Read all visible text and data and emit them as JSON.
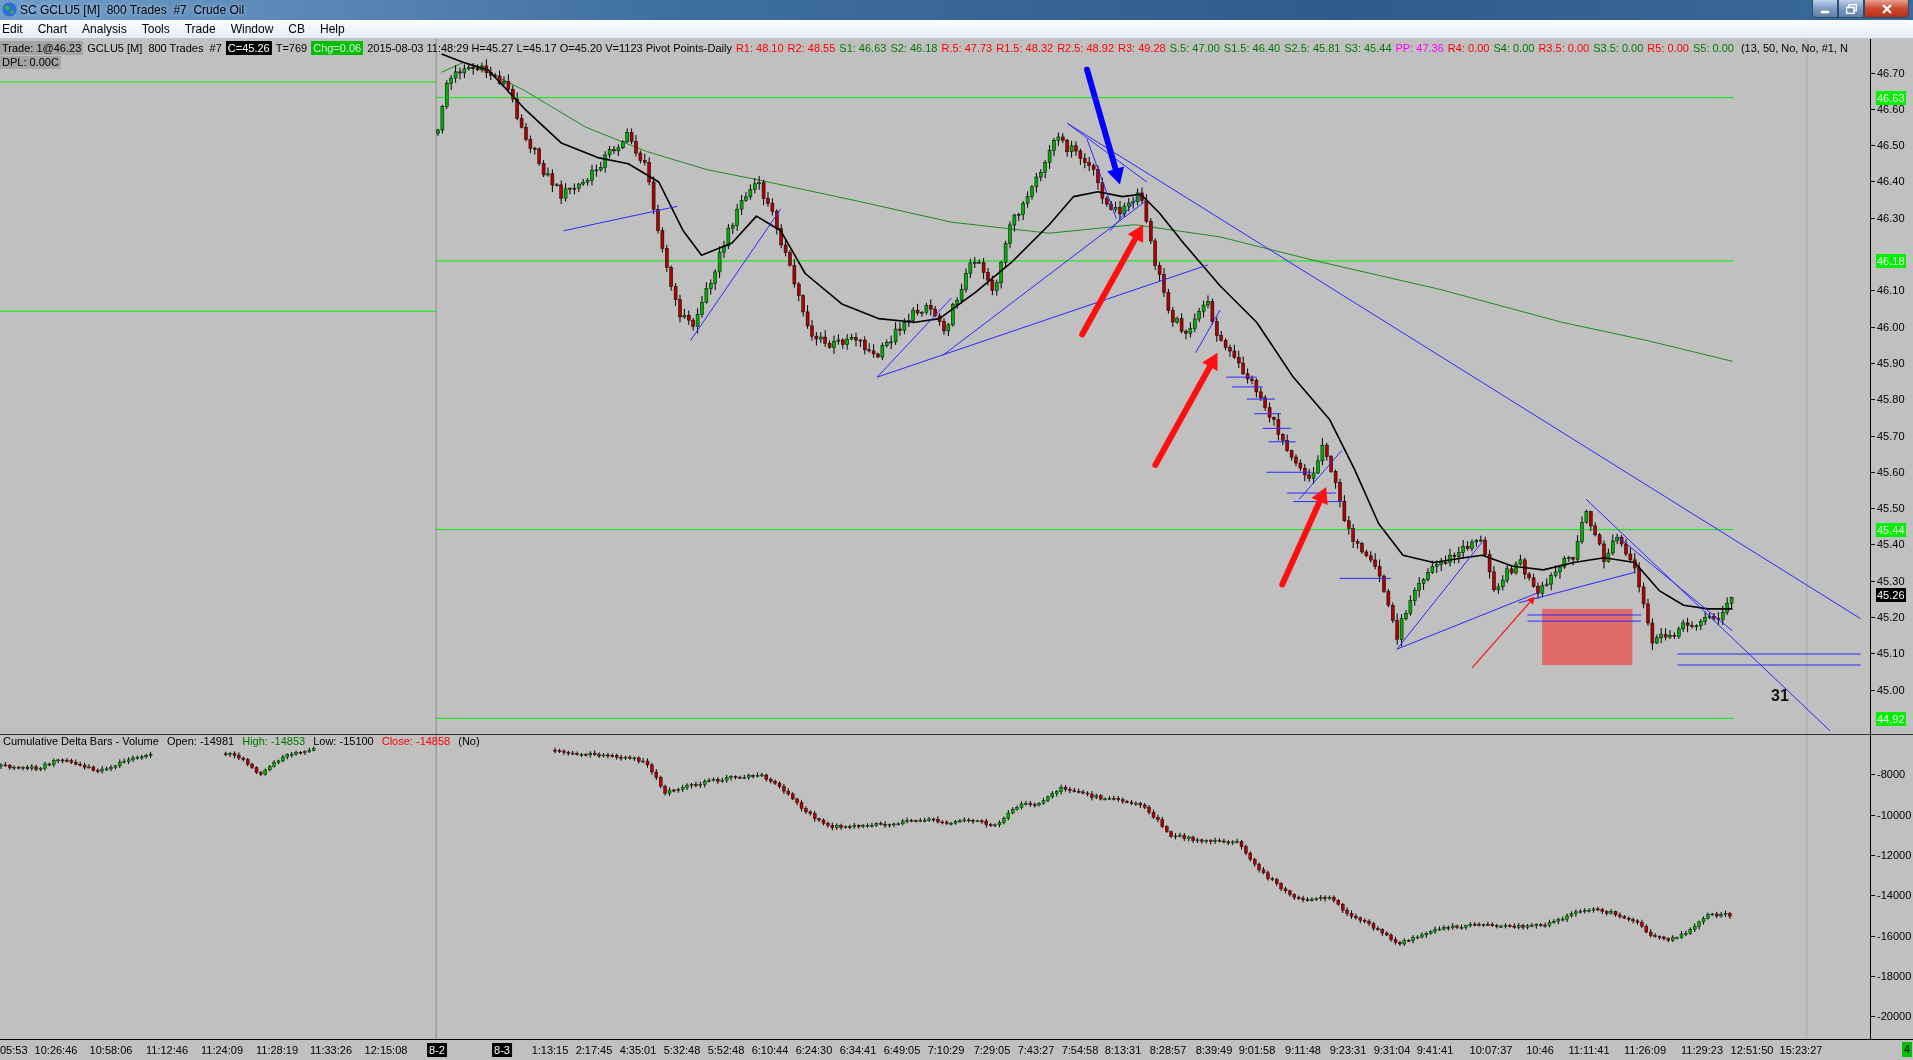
{
  "window": {
    "title": "SC GCLU5 [M]  800 Trades  #7  Crude Oil"
  },
  "menu": [
    "Edit",
    "Chart",
    "Analysis",
    "Tools",
    "Trade",
    "Window",
    "CB",
    "Help"
  ],
  "info_bar": {
    "trade": "Trade: 1@46.23",
    "symbol": "GCLU5 [M]  800 Trades  #7",
    "close": "C=45.26",
    "trades": "T=769",
    "change": "Chg=0.06",
    "bar_info": "2015-08-03 11:48:29 H=45.27 L=45.17 O=45.20 V=1123 Pivot Points-Daily",
    "pivot_values": [
      {
        "text": "R1: 48.10",
        "color": "#ff0000"
      },
      {
        "text": "R2: 48.55",
        "color": "#ff0000"
      },
      {
        "text": "S1: 46.63",
        "color": "#007800"
      },
      {
        "text": "S2: 46.18",
        "color": "#007800"
      },
      {
        "text": "R.5: 47.73",
        "color": "#ff0000"
      },
      {
        "text": "R1.5: 48.32",
        "color": "#ff0000"
      },
      {
        "text": "R2.5: 48.92",
        "color": "#ff0000"
      },
      {
        "text": "R3: 49.28",
        "color": "#ff0000"
      },
      {
        "text": "S.5: 47.00",
        "color": "#007800"
      },
      {
        "text": "S1.5: 46.40",
        "color": "#007800"
      },
      {
        "text": "S2.5: 45.81",
        "color": "#007800"
      },
      {
        "text": "S3: 45.44",
        "color": "#007800"
      },
      {
        "text": "PP: 47.36",
        "color": "#ff00ff"
      },
      {
        "text": "R4: 0.00",
        "color": "#ff0000"
      },
      {
        "text": "S4: 0.00",
        "color": "#007800"
      },
      {
        "text": "R3.5: 0.00",
        "color": "#ff0000"
      },
      {
        "text": "S3.5: 0.00",
        "color": "#007800"
      },
      {
        "text": "R5: 0.00",
        "color": "#ff0000"
      },
      {
        "text": "S5: 0.00",
        "color": "#007800"
      }
    ],
    "study_params": "(13, 50, No, No, #1, N",
    "dpl": "DPL: 0.00C"
  },
  "price_chart": {
    "annotation": "31",
    "price_axis": [
      "46.70",
      "46.60",
      "46.50",
      "46.40",
      "46.30",
      "46.10",
      "46.00",
      "45.90",
      "45.80",
      "45.70",
      "45.60",
      "45.50",
      "45.40",
      "45.30",
      "45.20",
      "45.10",
      "45.00"
    ],
    "level_tags": [
      "46.63",
      "46.18",
      "45.44",
      "44.92"
    ],
    "last_price": "45.26"
  },
  "delta_pane": {
    "title": "Cumulative Delta Bars - Volume",
    "open": "Open: -14981",
    "high": "High: -14853",
    "low": "Low: -15100",
    "close": "Close: -14858",
    "mode": "(No)",
    "axis": [
      "-8000",
      "-10000",
      "-12000",
      "-14000",
      "-16000",
      "-18000",
      "-20000"
    ]
  },
  "time_axis": {
    "labels": [
      {
        "text": "05:53",
        "kind": "time"
      },
      {
        "text": "10:26:46",
        "kind": "time"
      },
      {
        "text": "10:58:06",
        "kind": "time"
      },
      {
        "text": "11:12:46",
        "kind": "time"
      },
      {
        "text": "11:24:09",
        "kind": "time"
      },
      {
        "text": "11:28:19",
        "kind": "time"
      },
      {
        "text": "11:33:26",
        "kind": "time"
      },
      {
        "text": "12:15:08",
        "kind": "time"
      },
      {
        "text": "8-2",
        "kind": "date"
      },
      {
        "text": "8-3",
        "kind": "date"
      },
      {
        "text": "1:13:15",
        "kind": "time"
      },
      {
        "text": "2:17:45",
        "kind": "time"
      },
      {
        "text": "4:35:01",
        "kind": "time"
      },
      {
        "text": "5:32:48",
        "kind": "time"
      },
      {
        "text": "5:52:48",
        "kind": "time"
      },
      {
        "text": "6:10:44",
        "kind": "time"
      },
      {
        "text": "6:24:30",
        "kind": "time"
      },
      {
        "text": "6:34:41",
        "kind": "time"
      },
      {
        "text": "6:49:05",
        "kind": "time"
      },
      {
        "text": "7:10:29",
        "kind": "time"
      },
      {
        "text": "7:29:05",
        "kind": "time"
      },
      {
        "text": "7:43:27",
        "kind": "time"
      },
      {
        "text": "7:54:58",
        "kind": "time"
      },
      {
        "text": "8:13:31",
        "kind": "time"
      },
      {
        "text": "8:28:57",
        "kind": "time"
      },
      {
        "text": "8:39:49",
        "kind": "time"
      },
      {
        "text": "9:01:58",
        "kind": "time"
      },
      {
        "text": "9:11:48",
        "kind": "time"
      },
      {
        "text": "9:23:31",
        "kind": "time"
      },
      {
        "text": "9:31:04",
        "kind": "time"
      },
      {
        "text": "9:41:41",
        "kind": "time"
      },
      {
        "text": "10:07:37",
        "kind": "time"
      },
      {
        "text": "10:46",
        "kind": "time"
      },
      {
        "text": "11:11:41",
        "kind": "time"
      },
      {
        "text": "11:26:09",
        "kind": "time"
      },
      {
        "text": "11:29:23",
        "kind": "time"
      },
      {
        "text": "12:51:50",
        "kind": "time"
      },
      {
        "text": "15:23:27",
        "kind": "time"
      }
    ],
    "status": "4"
  }
}
